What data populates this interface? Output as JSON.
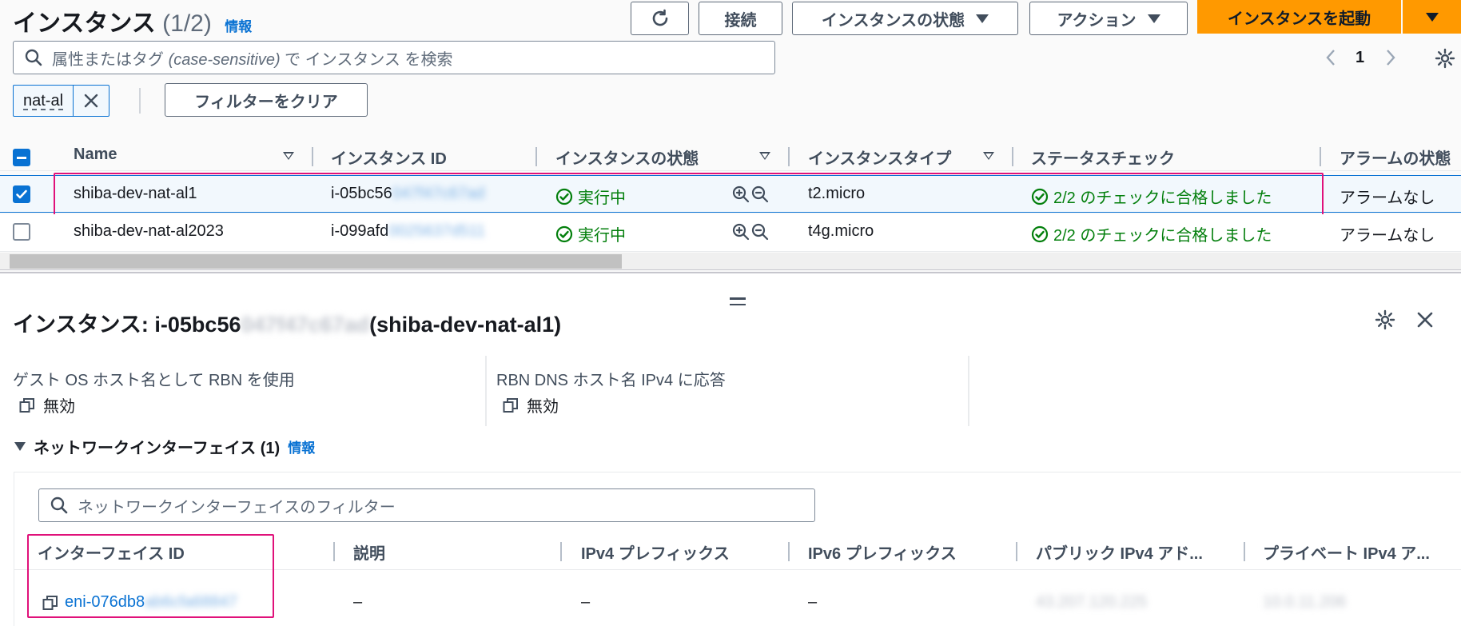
{
  "header": {
    "title": "インスタンス",
    "count": "(1/2)",
    "info": "情報"
  },
  "toolbar": {
    "connect": "接続",
    "instance_state": "インスタンスの状態",
    "actions": "アクション",
    "launch": "インスタンスを起動"
  },
  "search": {
    "placeholder_prefix": "属性またはタグ ",
    "placeholder_italic": "(case-sensitive)",
    "placeholder_suffix": " で インスタンス を検索"
  },
  "pagination": {
    "page": "1"
  },
  "filter": {
    "token": "nat-al",
    "clear": "フィルターをクリア"
  },
  "table": {
    "columns": [
      "Name",
      "インスタンス ID",
      "インスタンスの状態",
      "インスタンスタイプ",
      "ステータスチェック",
      "アラームの状態"
    ],
    "rows": [
      {
        "selected": true,
        "name": "shiba-dev-nat-al1",
        "id_visible": "i-05bc56",
        "id_hidden": "047f47c67ad",
        "state": "実行中",
        "type": "t2.micro",
        "status": "2/2 のチェックに合格しました",
        "alarm": "アラームなし"
      },
      {
        "selected": false,
        "name": "shiba-dev-nat-al2023",
        "id_visible": "i-099afd",
        "id_hidden": "0025637d511",
        "state": "実行中",
        "type": "t4g.micro",
        "status": "2/2 のチェックに合格しました",
        "alarm": "アラームなし"
      }
    ]
  },
  "detail": {
    "title_prefix": "インスタンス: i-05bc56",
    "title_hidden": "047f47c67ad",
    "title_suffix": "(shiba-dev-nat-al1)",
    "fields": [
      {
        "label": "ゲスト OS ホスト名として RBN を使用",
        "value": "無効"
      },
      {
        "label": "RBN DNS ホスト名 IPv4 に応答",
        "value": "無効"
      }
    ],
    "network_section": {
      "title": "ネットワークインターフェイス (1)",
      "info": "情報",
      "filter_placeholder": "ネットワークインターフェイスのフィルター",
      "columns": [
        "インターフェイス ID",
        "説明",
        "IPv4 プレフィックス",
        "IPv6 プレフィックス",
        "パブリック IPv4 アド...",
        "プライベート IPv4 ア..."
      ],
      "row": {
        "id_visible": "eni-076db8",
        "id_hidden": "ab6cfa68847",
        "description": "–",
        "ipv4_prefix": "–",
        "ipv6_prefix": "–",
        "public_ip": "43.207.120.225",
        "private_ip": "10.0.11.206"
      }
    }
  },
  "colors": {
    "accent": "#0972d3",
    "primary_button": "#ff9900",
    "success": "#037f0c",
    "highlight": "#e0117a"
  }
}
